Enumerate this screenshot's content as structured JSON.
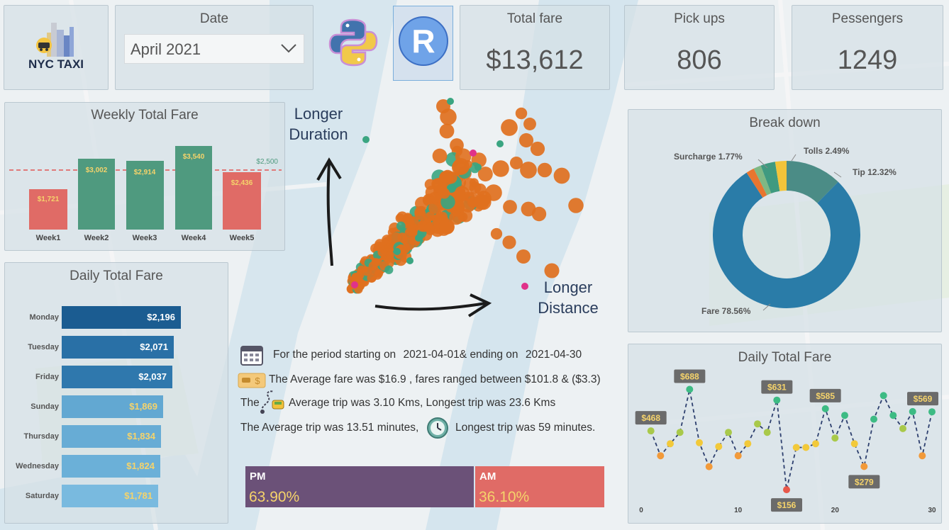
{
  "logo": {
    "text": "NYC TAXI"
  },
  "date_filter": {
    "title": "Date",
    "selected": "April 2021"
  },
  "r_button": {
    "label": "R"
  },
  "kpis": [
    {
      "id": "total-fare",
      "title": "Total fare",
      "value": "$13,612"
    },
    {
      "id": "pick-ups",
      "title": "Pick ups",
      "value": "806"
    },
    {
      "id": "passengers",
      "title": "Pessengers",
      "value": "1249"
    }
  ],
  "weekly": {
    "title": "Weekly Total Fare",
    "target_label": "$2,500",
    "bars": [
      {
        "label": "Week1",
        "value_label": "$1,721",
        "color": "#e06b66"
      },
      {
        "label": "Week2",
        "value_label": "$3,002",
        "color": "#4f9a7f"
      },
      {
        "label": "Week3",
        "value_label": "$2,914",
        "color": "#4f9a7f"
      },
      {
        "label": "Week4",
        "value_label": "$3,540",
        "color": "#4f9a7f"
      },
      {
        "label": "Week5",
        "value_label": "$2,436",
        "color": "#e06b66"
      }
    ]
  },
  "daily_bars": {
    "title": "Daily Total Fare",
    "rows": [
      {
        "label": "Monday",
        "value_label": "$2,196",
        "color": "#1b5c91",
        "text_color": "#ffffff"
      },
      {
        "label": "Tuesday",
        "value_label": "$2,071",
        "color": "#2970a6",
        "text_color": "#ffffff"
      },
      {
        "label": "Friday",
        "value_label": "$2,037",
        "color": "#2f78ad",
        "text_color": "#ffffff"
      },
      {
        "label": "Sunday",
        "value_label": "$1,869",
        "color": "#62a8d2",
        "text_color": "#f5d36b"
      },
      {
        "label": "Thursday",
        "value_label": "$1,834",
        "color": "#67acd5",
        "text_color": "#f5d36b"
      },
      {
        "label": "Wednesday",
        "value_label": "$1,824",
        "color": "#6bb0d8",
        "text_color": "#f5d36b"
      },
      {
        "label": "Saturday",
        "value_label": "$1,781",
        "color": "#79badf",
        "text_color": "#f5d36b"
      }
    ]
  },
  "scatter": {
    "label_duration_1": "Longer",
    "label_duration_2": "Duration",
    "label_distance_1": "Longer",
    "label_distance_2": "Distance"
  },
  "summary": {
    "line1_a": "For the period starting on",
    "line1_start": "2021-04-01",
    "line1_b": "& ending on",
    "line1_end": "2021-04-30",
    "line2": "The Average fare was $16.9 , fares ranged between $101.8 & ($3.3)",
    "line3_a": "The",
    "line3_b": "Average trip was 3.10 Kms, Longest trip was 23.6 Kms",
    "line4_a": "The Average trip was 13.51 minutes,",
    "line4_b": "Longest trip was 59 minutes."
  },
  "pm_am": {
    "pm_label": "PM",
    "pm_value": "63.90%",
    "pm_color": "#6b5178",
    "am_label": "AM",
    "am_value": "36.10%",
    "am_color": "#e06b66"
  },
  "breakdown": {
    "title": "Break down",
    "slices": [
      {
        "label": "Fare 78.56%",
        "value": 78.56,
        "color": "#2a7ca8"
      },
      {
        "label": "Surcharge 1.77%",
        "value": 1.77,
        "color": "#e8752f"
      },
      {
        "label": "",
        "value": 1.66,
        "color": "#7fb884"
      },
      {
        "label": "",
        "value": 3.2,
        "color": "#3f9a80"
      },
      {
        "label": "Tolls 2.49%",
        "value": 2.49,
        "color": "#f2c43a"
      },
      {
        "label": "Tip 12.32%",
        "value": 12.32,
        "color": "#4b8c86"
      }
    ]
  },
  "chart_data": {
    "type": "line",
    "title": "Daily Total Fare",
    "x_ticks": [
      "0",
      "10",
      "20",
      "30"
    ],
    "x": [
      1,
      2,
      3,
      4,
      5,
      6,
      7,
      8,
      9,
      10,
      11,
      12,
      13,
      14,
      15,
      16,
      17,
      18,
      19,
      20,
      21,
      22,
      23,
      24,
      25,
      26,
      27,
      28,
      29,
      30
    ],
    "values": [
      468,
      336,
      400,
      460,
      688,
      405,
      278,
      385,
      460,
      336,
      400,
      505,
      460,
      631,
      156,
      380,
      380,
      400,
      585,
      430,
      550,
      400,
      279,
      530,
      655,
      550,
      480,
      570,
      336,
      569
    ],
    "data_labels": [
      {
        "x": 1,
        "label": "$468"
      },
      {
        "x": 5,
        "label": "$688"
      },
      {
        "x": 14,
        "label": "$631"
      },
      {
        "x": 15,
        "label": "$156"
      },
      {
        "x": 19,
        "label": "$585"
      },
      {
        "x": 23,
        "label": "$279"
      },
      {
        "x": 30,
        "label": "$569"
      }
    ],
    "xlim": [
      0,
      30
    ],
    "ylim": [
      100,
      720
    ]
  }
}
